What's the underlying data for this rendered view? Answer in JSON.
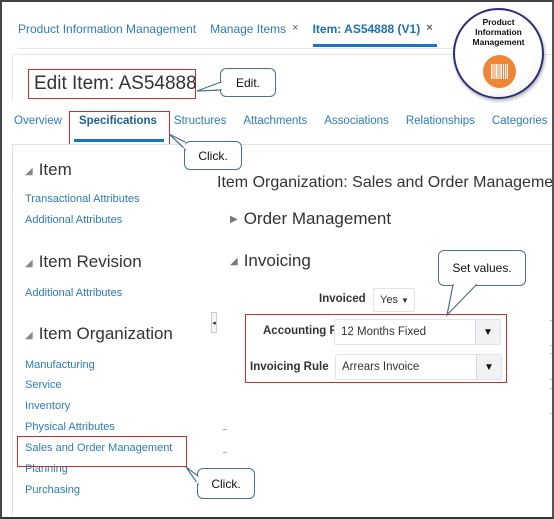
{
  "top_tabs": [
    {
      "label": "Product Information Management",
      "closable": false,
      "active": false
    },
    {
      "label": "Manage Items",
      "closable": true,
      "active": false
    },
    {
      "label": "Item: AS54888 (V1)",
      "closable": true,
      "active": true
    }
  ],
  "close_glyph": "×",
  "page_title": "Edit Item: AS54888",
  "badge": {
    "line1": "Product",
    "line2": "Information",
    "line3": "Management",
    "icon": "barcode-icon",
    "color": "#ef8636"
  },
  "sub_tabs": [
    {
      "label": "Overview",
      "active": false
    },
    {
      "label": "Specifications",
      "active": true
    },
    {
      "label": "Structures",
      "active": false
    },
    {
      "label": "Attachments",
      "active": false
    },
    {
      "label": "Associations",
      "active": false
    },
    {
      "label": "Relationships",
      "active": false
    },
    {
      "label": "Categories",
      "active": false
    }
  ],
  "left_nav": {
    "groups": [
      {
        "title": "Item",
        "links": [
          "Transactional Attributes",
          "Additional Attributes"
        ]
      },
      {
        "title": "Item Revision",
        "links": [
          "Additional Attributes"
        ]
      },
      {
        "title": "Item Organization",
        "links": [
          "Manufacturing",
          "Service",
          "Inventory",
          "Physical Attributes",
          "Sales and Order Management",
          "Planning",
          "Purchasing"
        ]
      }
    ]
  },
  "content": {
    "section_title": "Item Organization: Sales and Order Management",
    "groups": {
      "order_management": {
        "title": "Order Management",
        "expanded": false
      },
      "invoicing": {
        "title": "Invoicing",
        "expanded": true
      }
    },
    "fields": {
      "invoiced": {
        "label": "Invoiced",
        "value": "Yes"
      },
      "accounting_rule": {
        "label": "Accounting Rule",
        "value": "12 Months Fixed"
      },
      "invoicing_rule": {
        "label": "Invoicing Rule",
        "value": "Arrears Invoice"
      }
    }
  },
  "callouts": {
    "edit": "Edit.",
    "click_tab": "Click.",
    "set_values": "Set values.",
    "click_link": "Click."
  },
  "colors": {
    "link": "#2e7bb8",
    "active_underline": "#1b74c8",
    "highlight_box": "#c42f2f",
    "callout_border": "#4a6f95"
  }
}
